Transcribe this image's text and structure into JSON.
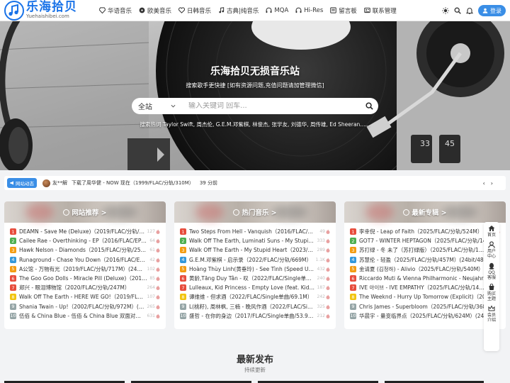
{
  "header": {
    "logo_cn": "乐海拾贝",
    "logo_en": "Yuehaishibei.com",
    "nav": [
      {
        "label": "华语音乐",
        "icon": "diamond-icon"
      },
      {
        "label": "欧美音乐",
        "icon": "disc-icon"
      },
      {
        "label": "日韩音乐",
        "icon": "heart-icon"
      },
      {
        "label": "古典|纯音乐",
        "icon": "music-note-icon"
      },
      {
        "label": "MQA",
        "icon": "headphones-icon"
      },
      {
        "label": "Hi-Res",
        "icon": "headphones-icon"
      },
      {
        "label": "留言板",
        "icon": "message-board-icon"
      },
      {
        "label": "联系管理",
        "icon": "contact-icon"
      }
    ],
    "login_label": "登录"
  },
  "hero": {
    "title": "乐海拾贝无损音乐站",
    "subtitle": "搜索歌手更快捷 [如有资源问题,充值问题请加管理微信]",
    "search": {
      "scope": "全站",
      "placeholder": "输入关键词 回车..."
    },
    "hot_searches": "搜索热词  Taylor Swift, 周杰伦, G.E.M.邓紫棋, 林俊杰, 张学友, 刘德华, 周传雄, Ed Sheeran......"
  },
  "activity": {
    "badge": "网站动态",
    "user": "友**解",
    "text": "下载了周华健 - NOW 现在（1999/FLAC/分轨/310M）",
    "time": "39 分前",
    "prev": "‹",
    "next": "›"
  },
  "cards": [
    {
      "title": "网站推荐 >",
      "items": [
        {
          "title": "DEAMN - Save Me (Deluxe)（2019/FLAC/分轨/29...",
          "count": "127"
        },
        {
          "title": "Cailee Rae - Overthinking - EP（2016/FLAC/EP分轨...",
          "count": "64"
        },
        {
          "title": "Hawk Nelson - Diamonds（2015/FLAC/分轨/258M）",
          "count": "61"
        },
        {
          "title": "Runaground - Chase You Down（2016/FLAC/EP分轨...",
          "count": "42"
        },
        {
          "title": "A公馆 - 万物有光（2019/FLAC/分轨/717M）(24bit...",
          "count": "102"
        },
        {
          "title": "The Goo Goo Dolls - Miracle Pill (Deluxe)（2019/...",
          "count": "85"
        },
        {
          "title": "郑兴 - 眼泪博物馆（2020/FLAC/分轨/247M）",
          "count": "264"
        },
        {
          "title": "Walk Off The Earth - HERE WE GO!（2019/FLAC/...",
          "count": "107"
        },
        {
          "title": "Shania Twain - Up!（2002/FLAC/分轨/972M）(M...",
          "count": "265"
        },
        {
          "title": "伍佰 & China Blue - 伍佰 & China Blue 双面对决演...",
          "count": "631"
        }
      ]
    },
    {
      "title": "热门音乐 >",
      "items": [
        {
          "title": "Two Steps From Hell - Vanquish（2016/FLAC/分...",
          "count": "49"
        },
        {
          "title": "Walk Off The Earth, Luminati Suns - My Stupid H...",
          "count": "333"
        },
        {
          "title": "Walk Off The Earth - My Stupid Heart（2023/FLA...",
          "count": "289"
        },
        {
          "title": "G.E.M.邓紫棋 - 启示录（2022/FLAC/分轨/669M）",
          "count": "1.1K"
        },
        {
          "title": "Hoàng Thùy Linh(黄垂玲) - See Tình (Speed Up V...",
          "count": "432"
        },
        {
          "title": "黄龄,Tăng Duy Tân - 叹（2022/FLAC/Single单曲/5...",
          "count": "240"
        },
        {
          "title": "Lulleaux, Kid Princess - Empty Love (feat. Kid Pri...",
          "count": "187"
        },
        {
          "title": "谭维维 - 但求酒（2022/FLAC/Single单曲/69.1M）",
          "count": "242"
        },
        {
          "title": "L(桃籽), 周林枫, 三楠 - 晚风作酒（2022/FLAC/Sing...",
          "count": "325"
        },
        {
          "title": "盛哲 - 在你的身边（2017/FLAC/Single单曲/53.9M...",
          "count": "212"
        }
      ]
    },
    {
      "title": "最新专辑 >",
      "items": [
        {
          "title": "李幸倪 - Leap of Faith（2025/FLAC/分轨/524M）",
          "count": "25"
        },
        {
          "title": "GOT7 - WINTER HEPTAGON（2025/FLAC/分轨/14...",
          "count": ""
        },
        {
          "title": "苏打绿 - 冬 未了（苏打绿版）（2025/FLAC/分轨/1...",
          "count": ""
        },
        {
          "title": "苏慧伦 - 轻盈（2025/FLAC/分轨/457M）(24bit/48k...",
          "count": ""
        },
        {
          "title": "金请夏 (김청하) - Alivio（2025/FLAC/分轨/540M）(...",
          "count": ""
        },
        {
          "title": "Riccardo Muti & Vienna Philharmonic - Neujahrsk...",
          "count": ""
        },
        {
          "title": "IVE 아이브 - IVE EMPATHY（2025/FLAC/分轨/14...",
          "count": ""
        },
        {
          "title": "The Weeknd - Hurry Up Tomorrow (Explicit)（20...",
          "count": ""
        },
        {
          "title": "Chris James - Superbloom（2025/FLAC/分轨/368...",
          "count": ""
        },
        {
          "title": "华晨宇 - 量变临界点（2025/FLAC/分轨/624M）(24...",
          "count": ""
        }
      ]
    }
  ],
  "sidefloat": [
    {
      "label": "首页",
      "icon": "home-icon"
    },
    {
      "label": "用户中心",
      "icon": "user-icon"
    },
    {
      "label": "QQ客服",
      "icon": "qq-icon"
    },
    {
      "label": "购买主题",
      "icon": "shopping-icon"
    },
    {
      "label": "会员介绍",
      "icon": "crown-icon"
    }
  ],
  "latest": {
    "title": "最新发布",
    "subtitle": "持续更新"
  },
  "colors": {
    "accent": "#3a8ee6",
    "logo": "#1a73e8",
    "page_bg": "#f2f3f5"
  }
}
